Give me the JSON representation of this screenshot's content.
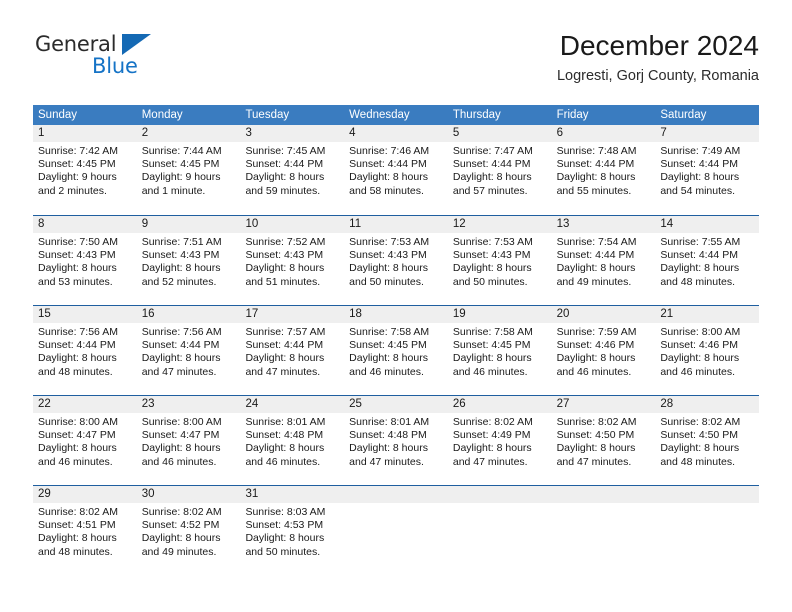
{
  "brand": {
    "name_part1": "General",
    "name_part2": "Blue",
    "logo_icon": "triangle-logo-icon"
  },
  "header": {
    "month_title": "December 2024",
    "location": "Logresti, Gorj County, Romania"
  },
  "colors": {
    "header_blue": "#3a7cc0",
    "row_border_blue": "#1f5fa0",
    "day_band_gray": "#efefef",
    "brand_blue": "#1573c6"
  },
  "weekdays": [
    "Sunday",
    "Monday",
    "Tuesday",
    "Wednesday",
    "Thursday",
    "Friday",
    "Saturday"
  ],
  "weeks": [
    [
      {
        "day": "1",
        "sunrise": "Sunrise: 7:42 AM",
        "sunset": "Sunset: 4:45 PM",
        "daylight1": "Daylight: 9 hours",
        "daylight2": "and 2 minutes."
      },
      {
        "day": "2",
        "sunrise": "Sunrise: 7:44 AM",
        "sunset": "Sunset: 4:45 PM",
        "daylight1": "Daylight: 9 hours",
        "daylight2": "and 1 minute."
      },
      {
        "day": "3",
        "sunrise": "Sunrise: 7:45 AM",
        "sunset": "Sunset: 4:44 PM",
        "daylight1": "Daylight: 8 hours",
        "daylight2": "and 59 minutes."
      },
      {
        "day": "4",
        "sunrise": "Sunrise: 7:46 AM",
        "sunset": "Sunset: 4:44 PM",
        "daylight1": "Daylight: 8 hours",
        "daylight2": "and 58 minutes."
      },
      {
        "day": "5",
        "sunrise": "Sunrise: 7:47 AM",
        "sunset": "Sunset: 4:44 PM",
        "daylight1": "Daylight: 8 hours",
        "daylight2": "and 57 minutes."
      },
      {
        "day": "6",
        "sunrise": "Sunrise: 7:48 AM",
        "sunset": "Sunset: 4:44 PM",
        "daylight1": "Daylight: 8 hours",
        "daylight2": "and 55 minutes."
      },
      {
        "day": "7",
        "sunrise": "Sunrise: 7:49 AM",
        "sunset": "Sunset: 4:44 PM",
        "daylight1": "Daylight: 8 hours",
        "daylight2": "and 54 minutes."
      }
    ],
    [
      {
        "day": "8",
        "sunrise": "Sunrise: 7:50 AM",
        "sunset": "Sunset: 4:43 PM",
        "daylight1": "Daylight: 8 hours",
        "daylight2": "and 53 minutes."
      },
      {
        "day": "9",
        "sunrise": "Sunrise: 7:51 AM",
        "sunset": "Sunset: 4:43 PM",
        "daylight1": "Daylight: 8 hours",
        "daylight2": "and 52 minutes."
      },
      {
        "day": "10",
        "sunrise": "Sunrise: 7:52 AM",
        "sunset": "Sunset: 4:43 PM",
        "daylight1": "Daylight: 8 hours",
        "daylight2": "and 51 minutes."
      },
      {
        "day": "11",
        "sunrise": "Sunrise: 7:53 AM",
        "sunset": "Sunset: 4:43 PM",
        "daylight1": "Daylight: 8 hours",
        "daylight2": "and 50 minutes."
      },
      {
        "day": "12",
        "sunrise": "Sunrise: 7:53 AM",
        "sunset": "Sunset: 4:43 PM",
        "daylight1": "Daylight: 8 hours",
        "daylight2": "and 50 minutes."
      },
      {
        "day": "13",
        "sunrise": "Sunrise: 7:54 AM",
        "sunset": "Sunset: 4:44 PM",
        "daylight1": "Daylight: 8 hours",
        "daylight2": "and 49 minutes."
      },
      {
        "day": "14",
        "sunrise": "Sunrise: 7:55 AM",
        "sunset": "Sunset: 4:44 PM",
        "daylight1": "Daylight: 8 hours",
        "daylight2": "and 48 minutes."
      }
    ],
    [
      {
        "day": "15",
        "sunrise": "Sunrise: 7:56 AM",
        "sunset": "Sunset: 4:44 PM",
        "daylight1": "Daylight: 8 hours",
        "daylight2": "and 48 minutes."
      },
      {
        "day": "16",
        "sunrise": "Sunrise: 7:56 AM",
        "sunset": "Sunset: 4:44 PM",
        "daylight1": "Daylight: 8 hours",
        "daylight2": "and 47 minutes."
      },
      {
        "day": "17",
        "sunrise": "Sunrise: 7:57 AM",
        "sunset": "Sunset: 4:44 PM",
        "daylight1": "Daylight: 8 hours",
        "daylight2": "and 47 minutes."
      },
      {
        "day": "18",
        "sunrise": "Sunrise: 7:58 AM",
        "sunset": "Sunset: 4:45 PM",
        "daylight1": "Daylight: 8 hours",
        "daylight2": "and 46 minutes."
      },
      {
        "day": "19",
        "sunrise": "Sunrise: 7:58 AM",
        "sunset": "Sunset: 4:45 PM",
        "daylight1": "Daylight: 8 hours",
        "daylight2": "and 46 minutes."
      },
      {
        "day": "20",
        "sunrise": "Sunrise: 7:59 AM",
        "sunset": "Sunset: 4:46 PM",
        "daylight1": "Daylight: 8 hours",
        "daylight2": "and 46 minutes."
      },
      {
        "day": "21",
        "sunrise": "Sunrise: 8:00 AM",
        "sunset": "Sunset: 4:46 PM",
        "daylight1": "Daylight: 8 hours",
        "daylight2": "and 46 minutes."
      }
    ],
    [
      {
        "day": "22",
        "sunrise": "Sunrise: 8:00 AM",
        "sunset": "Sunset: 4:47 PM",
        "daylight1": "Daylight: 8 hours",
        "daylight2": "and 46 minutes."
      },
      {
        "day": "23",
        "sunrise": "Sunrise: 8:00 AM",
        "sunset": "Sunset: 4:47 PM",
        "daylight1": "Daylight: 8 hours",
        "daylight2": "and 46 minutes."
      },
      {
        "day": "24",
        "sunrise": "Sunrise: 8:01 AM",
        "sunset": "Sunset: 4:48 PM",
        "daylight1": "Daylight: 8 hours",
        "daylight2": "and 46 minutes."
      },
      {
        "day": "25",
        "sunrise": "Sunrise: 8:01 AM",
        "sunset": "Sunset: 4:48 PM",
        "daylight1": "Daylight: 8 hours",
        "daylight2": "and 47 minutes."
      },
      {
        "day": "26",
        "sunrise": "Sunrise: 8:02 AM",
        "sunset": "Sunset: 4:49 PM",
        "daylight1": "Daylight: 8 hours",
        "daylight2": "and 47 minutes."
      },
      {
        "day": "27",
        "sunrise": "Sunrise: 8:02 AM",
        "sunset": "Sunset: 4:50 PM",
        "daylight1": "Daylight: 8 hours",
        "daylight2": "and 47 minutes."
      },
      {
        "day": "28",
        "sunrise": "Sunrise: 8:02 AM",
        "sunset": "Sunset: 4:50 PM",
        "daylight1": "Daylight: 8 hours",
        "daylight2": "and 48 minutes."
      }
    ],
    [
      {
        "day": "29",
        "sunrise": "Sunrise: 8:02 AM",
        "sunset": "Sunset: 4:51 PM",
        "daylight1": "Daylight: 8 hours",
        "daylight2": "and 48 minutes."
      },
      {
        "day": "30",
        "sunrise": "Sunrise: 8:02 AM",
        "sunset": "Sunset: 4:52 PM",
        "daylight1": "Daylight: 8 hours",
        "daylight2": "and 49 minutes."
      },
      {
        "day": "31",
        "sunrise": "Sunrise: 8:03 AM",
        "sunset": "Sunset: 4:53 PM",
        "daylight1": "Daylight: 8 hours",
        "daylight2": "and 50 minutes."
      },
      {
        "day": "",
        "sunrise": "",
        "sunset": "",
        "daylight1": "",
        "daylight2": ""
      },
      {
        "day": "",
        "sunrise": "",
        "sunset": "",
        "daylight1": "",
        "daylight2": ""
      },
      {
        "day": "",
        "sunrise": "",
        "sunset": "",
        "daylight1": "",
        "daylight2": ""
      },
      {
        "day": "",
        "sunrise": "",
        "sunset": "",
        "daylight1": "",
        "daylight2": ""
      }
    ]
  ]
}
